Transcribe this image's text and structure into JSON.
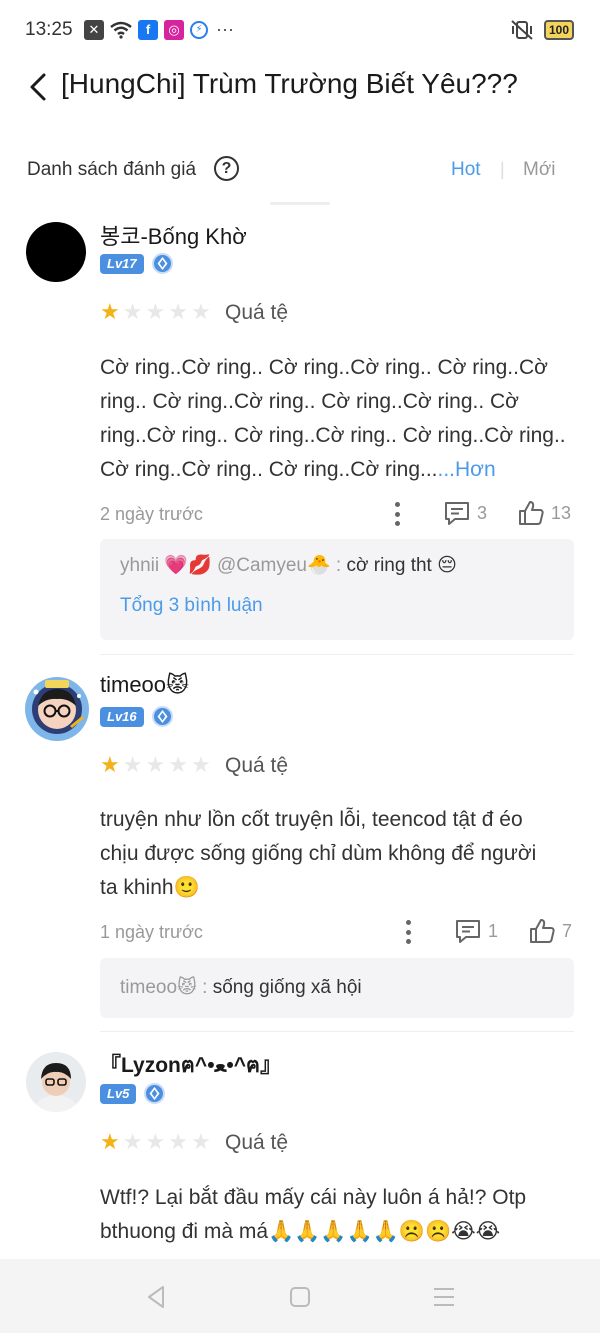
{
  "status_bar": {
    "time": "13:25",
    "icons": [
      "notification-icon",
      "wifi-icon",
      "facebook-icon",
      "instagram-icon",
      "messenger-icon"
    ],
    "more": "···",
    "battery": "100"
  },
  "header": {
    "title": "[HungChi] Trùm Trường Biết Yêu???"
  },
  "list": {
    "title": "Danh sách đánh giá",
    "sort_hot": "Hot",
    "sort_separator": "|",
    "sort_new": "Mới"
  },
  "colors": {
    "accent": "#4a9be8",
    "star": "#f3b21a",
    "level_badge": "#4a8fe0"
  },
  "reviews": [
    {
      "username": "봉코-Bống Khờ",
      "level": "Lv17",
      "stars": 1,
      "rating_label": "Quá tệ",
      "text": "Cờ ring..Cờ ring.. Cờ ring..Cờ ring.. Cờ ring..Cờ ring.. Cờ ring..Cờ ring.. Cờ ring..Cờ ring.. Cờ ring..Cờ ring.. Cờ ring..Cờ ring.. Cờ ring..Cờ ring.. Cờ ring..Cờ ring.. Cờ ring..Cờ ring...",
      "more": "...Hơn",
      "date": "2 ngày trước",
      "comments": "3",
      "likes": "13",
      "replies": [
        {
          "author": "yhnii 💗💋 @Camyeu🐣",
          "separator": " : ",
          "text": "cờ ring tht 😔"
        }
      ],
      "total_replies": "Tổng 3 bình luận"
    },
    {
      "username": "timeoo😾",
      "level": "Lv16",
      "stars": 1,
      "rating_label": "Quá tệ",
      "text": "truyện như lồn cốt truyện lỗi, teencod tật đ éo chịu được sống giống chỉ dùm không để người ta khinh🙂",
      "date": "1 ngày trước",
      "comments": "1",
      "likes": "7",
      "replies": [
        {
          "author": "timeoo😾",
          "separator": " : ",
          "text": "sống giống xã hội"
        }
      ]
    },
    {
      "username": "『Lyzonฅ^•ﻌ•^ฅ』",
      "level": "Lv5",
      "stars": 1,
      "rating_label": "Quá tệ",
      "text": "Wtf!? Lại bắt đầu mấy cái này luôn á hả!? Otp bthuong đi mà má🙏🙏🙏🙏🙏☹️☹️😭😭"
    }
  ],
  "nav": [
    "back-nav-icon",
    "home-nav-icon",
    "recents-nav-icon"
  ]
}
